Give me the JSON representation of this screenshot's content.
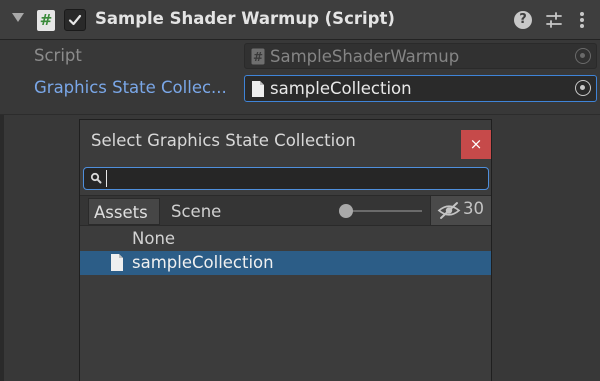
{
  "component": {
    "title": "Sample Shader Warmup (Script)",
    "script_icon_glyph": "#",
    "enabled": true,
    "icons": [
      "foldout-arrow-icon",
      "cs-script-icon",
      "checkbox-check-icon",
      "help-icon",
      "presets-icon",
      "kebab-menu-icon"
    ]
  },
  "properties": {
    "script_label": "Script",
    "script_value": "SampleShaderWarmup",
    "gsc_label": "Graphics State Collec...",
    "gsc_value": "sampleCollection"
  },
  "selector": {
    "title": "Select Graphics State Collection",
    "close_glyph": "×",
    "search_value": "",
    "tabs": {
      "assets": "Assets",
      "scene": "Scene"
    },
    "hidden_count": "30",
    "items": [
      {
        "label": "None",
        "icon": "",
        "selected": false
      },
      {
        "label": "sampleCollection",
        "icon": "document-icon",
        "selected": true
      }
    ]
  },
  "colors": {
    "accent": "#3f84d8",
    "label_link": "#7aa7e8",
    "selection": "#2c5d87",
    "close": "#c64a4a",
    "background": "#383838"
  }
}
